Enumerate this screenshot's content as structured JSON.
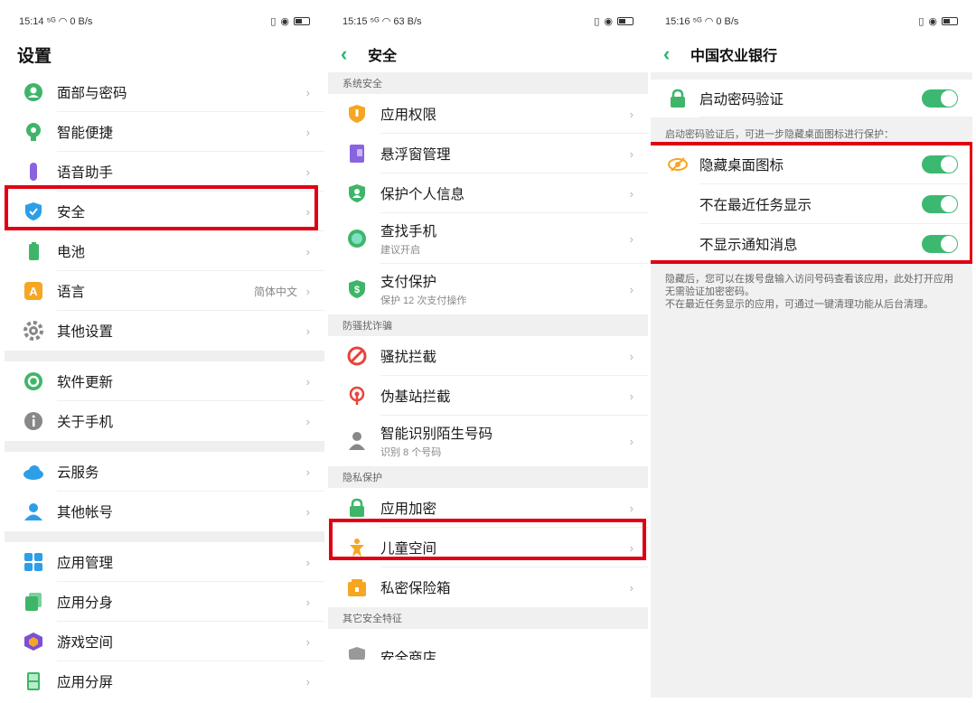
{
  "panels": [
    {
      "status": {
        "time": "15:14",
        "signal": "⁵ᴳ",
        "speed": "0 B/s"
      },
      "title": "设置",
      "items": [
        {
          "label": "面部与密码",
          "icon": "face-icon"
        },
        {
          "label": "智能便捷",
          "icon": "smart-icon"
        },
        {
          "label": "语音助手",
          "icon": "mic-icon"
        },
        {
          "label": "安全",
          "icon": "shield-icon"
        },
        {
          "label": "电池",
          "icon": "battery-icon"
        },
        {
          "label": "语言",
          "icon": "language-icon",
          "value": "简体中文"
        },
        {
          "label": "其他设置",
          "icon": "gear-icon"
        },
        {
          "label": "软件更新",
          "icon": "update-icon"
        },
        {
          "label": "关于手机",
          "icon": "info-icon"
        },
        {
          "label": "云服务",
          "icon": "cloud-icon"
        },
        {
          "label": "其他帐号",
          "icon": "account-icon"
        },
        {
          "label": "应用管理",
          "icon": "apps-icon"
        },
        {
          "label": "应用分身",
          "icon": "clone-icon"
        },
        {
          "label": "游戏空间",
          "icon": "game-icon"
        },
        {
          "label": "应用分屏",
          "icon": "split-icon"
        }
      ]
    },
    {
      "status": {
        "time": "15:15",
        "signal": "⁵ᴳ",
        "speed": "63 B/s"
      },
      "title": "安全",
      "sections": [
        {
          "header": "系统安全",
          "items": [
            {
              "label": "应用权限"
            },
            {
              "label": "悬浮窗管理"
            },
            {
              "label": "保护个人信息"
            },
            {
              "label": "查找手机",
              "sub": "建议开启"
            },
            {
              "label": "支付保护",
              "sub": "保护 12 次支付操作"
            }
          ]
        },
        {
          "header": "防骚扰诈骗",
          "items": [
            {
              "label": "骚扰拦截"
            },
            {
              "label": "伪基站拦截"
            },
            {
              "label": "智能识别陌生号码",
              "sub": "识别 8 个号码"
            }
          ]
        },
        {
          "header": "隐私保护",
          "items": [
            {
              "label": "应用加密"
            },
            {
              "label": "儿童空间"
            },
            {
              "label": "私密保险箱"
            }
          ]
        },
        {
          "header": "其它安全特征",
          "items": [
            {
              "label": "安全商店"
            }
          ]
        }
      ]
    },
    {
      "status": {
        "time": "15:16",
        "signal": "⁵ᴳ",
        "speed": "0 B/s"
      },
      "title": "中国农业银行",
      "items": [
        {
          "label": "启动密码验证",
          "on": true
        },
        {
          "label": "隐藏桌面图标",
          "on": true
        },
        {
          "label": "不在最近任务显示",
          "on": true
        },
        {
          "label": "不显示通知消息",
          "on": true
        }
      ],
      "note1": "启动密码验证后，可进一步隐藏桌面图标进行保护：",
      "note2": "隐藏后，您可以在拨号盘输入访问号码查看该应用，此处打开应用无需验证加密密码。",
      "note3": "不在最近任务显示的应用，可通过一键清理功能从后台清理。"
    }
  ],
  "colors": {
    "accent": "#2bb673",
    "toggle": "#3db870",
    "highlight": "#e00012"
  }
}
